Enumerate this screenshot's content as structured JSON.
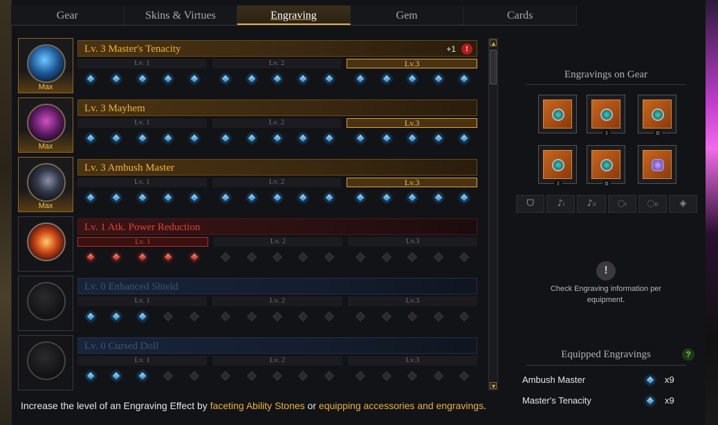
{
  "tabs": [
    "Gear",
    "Skins & Virtues",
    "Engraving",
    "Gem",
    "Cards"
  ],
  "active_tab": "Engraving",
  "engravings": [
    {
      "title": "Lv. 3 Master's Tenacity",
      "style": "gold",
      "max": "Max",
      "orb": "blue",
      "badge": "+1",
      "levels": [
        "Lv. 1",
        "Lv. 2",
        "Lv.3"
      ],
      "active_level": 3,
      "filled": 15,
      "gem_color": "blue"
    },
    {
      "title": "Lv. 3 Mayhem",
      "style": "gold",
      "max": "Max",
      "orb": "purple",
      "levels": [
        "Lv. 1",
        "Lv. 2",
        "Lv.3"
      ],
      "active_level": 3,
      "filled": 15,
      "gem_color": "blue"
    },
    {
      "title": "Lv. 3 Ambush Master",
      "style": "gold",
      "max": "Max",
      "orb": "moon",
      "levels": [
        "Lv. 1",
        "Lv. 2",
        "Lv.3"
      ],
      "active_level": 3,
      "filled": 15,
      "gem_color": "blue"
    },
    {
      "title": "Lv. 1 Atk. Power Reduction",
      "style": "red",
      "max": "",
      "orb": "fire",
      "levels": [
        "Lv. 1",
        "Lv. 2",
        "Lv.3"
      ],
      "active_level": 1,
      "filled": 5,
      "gem_color": "red"
    },
    {
      "title": "Lv. 0 Enhanced Shield",
      "style": "blue",
      "max": "",
      "orb": "dark",
      "levels": [
        "Lv. 1",
        "Lv. 2",
        "Lv.3"
      ],
      "active_level": 0,
      "filled": 3,
      "gem_color": "blue"
    },
    {
      "title": "Lv. 0 Cursed Doll",
      "style": "blue",
      "max": "",
      "orb": "dark",
      "levels": [
        "Lv. 1",
        "Lv. 2",
        "Lv.3"
      ],
      "active_level": 0,
      "filled": 3,
      "gem_color": "blue"
    }
  ],
  "right_panel": {
    "gear_title": "Engravings on Gear",
    "gear_slots": [
      {
        "icon": "necklace-icon",
        "roman": ""
      },
      {
        "icon": "earring-icon",
        "roman": "I"
      },
      {
        "icon": "earring-icon",
        "roman": "II"
      },
      {
        "icon": "ring-icon",
        "roman": "I"
      },
      {
        "icon": "ring-icon",
        "roman": "II"
      },
      {
        "icon": "ability-stone-icon",
        "roman": ""
      }
    ],
    "filter_icons": [
      "necklace-icon",
      "earring-1-icon",
      "earring-2-icon",
      "ring-1-icon",
      "ring-2-icon",
      "stone-icon"
    ],
    "info_text": "Check Engraving information per equipment.",
    "equipped_title": "Equipped Engravings",
    "equipped": [
      {
        "name": "Ambush Master",
        "count": "x9"
      },
      {
        "name": "Master's Tenacity",
        "count": "x9"
      }
    ]
  },
  "footer": {
    "prefix": "Increase the level of an Engraving Effect by ",
    "link1": "faceting Ability Stones",
    "mid": " or ",
    "link2": "equipping accessories and engravings",
    "suffix": "."
  },
  "colors": {
    "accent_gold": "#f0b43a",
    "negative_red": "#d9453a",
    "gem_blue": "#1b86d8"
  }
}
